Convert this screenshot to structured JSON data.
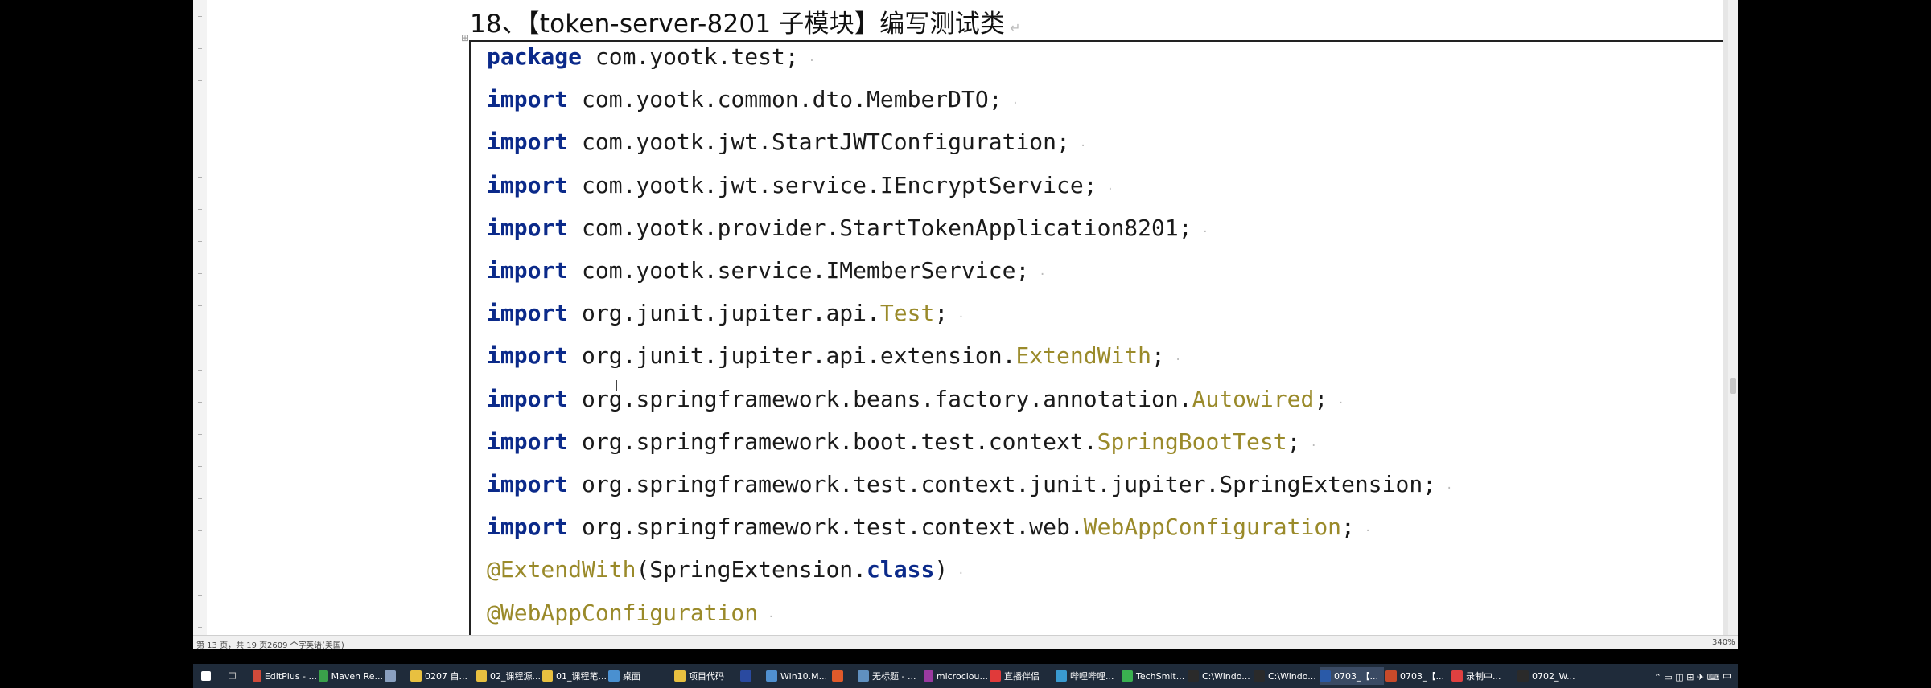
{
  "document": {
    "heading": "18、【token-server-8201 子模块】编写测试类",
    "code_lines": [
      [
        {
          "t": "package",
          "c": "kw"
        },
        {
          "t": " com.yootk.test;",
          "c": ""
        }
      ],
      [
        {
          "t": "import",
          "c": "kw"
        },
        {
          "t": " com.yootk.common.dto.MemberDTO;",
          "c": ""
        }
      ],
      [
        {
          "t": "import",
          "c": "kw"
        },
        {
          "t": " com.yootk.jwt.StartJWTConfiguration;",
          "c": ""
        }
      ],
      [
        {
          "t": "import",
          "c": "kw"
        },
        {
          "t": " com.yootk.jwt.service.IEncryptService;",
          "c": ""
        }
      ],
      [
        {
          "t": "import",
          "c": "kw"
        },
        {
          "t": " com.yootk.provider.StartTokenApplication8201;",
          "c": ""
        }
      ],
      [
        {
          "t": "import",
          "c": "kw"
        },
        {
          "t": " com.yootk.service.IMemberService;",
          "c": ""
        }
      ],
      [
        {
          "t": "import",
          "c": "kw"
        },
        {
          "t": " org.junit.jupiter.api.",
          "c": ""
        },
        {
          "t": "Test",
          "c": "cls"
        },
        {
          "t": ";",
          "c": ""
        }
      ],
      [
        {
          "t": "import",
          "c": "kw"
        },
        {
          "t": " org.junit.jupiter.api.extension.",
          "c": ""
        },
        {
          "t": "ExtendWith",
          "c": "cls"
        },
        {
          "t": ";",
          "c": ""
        }
      ],
      [
        {
          "t": "import",
          "c": "kw"
        },
        {
          "t": " org.springframework.beans.factory.annotation.",
          "c": ""
        },
        {
          "t": "Autowired",
          "c": "cls"
        },
        {
          "t": ";",
          "c": ""
        }
      ],
      [
        {
          "t": "import",
          "c": "kw"
        },
        {
          "t": " org.springframework.boot.test.context.",
          "c": ""
        },
        {
          "t": "SpringBootTest",
          "c": "cls"
        },
        {
          "t": ";",
          "c": ""
        }
      ],
      [
        {
          "t": "import",
          "c": "kw"
        },
        {
          "t": " org.springframework.test.context.junit.jupiter.SpringExtension;",
          "c": ""
        }
      ],
      [
        {
          "t": "import",
          "c": "kw"
        },
        {
          "t": " org.springframework.test.context.web.",
          "c": ""
        },
        {
          "t": "WebAppConfiguration",
          "c": "cls"
        },
        {
          "t": ";",
          "c": ""
        }
      ],
      [
        {
          "t": "@ExtendWith",
          "c": "ann"
        },
        {
          "t": "(SpringExtension.",
          "c": ""
        },
        {
          "t": "class",
          "c": "kw"
        },
        {
          "t": ")",
          "c": ""
        }
      ],
      [
        {
          "t": "@WebAppConfiguration",
          "c": "ann"
        }
      ]
    ]
  },
  "status_bar": {
    "page_info": "第 13 页，共 19 页",
    "word_count": "2609 个字",
    "language": "英语(美国)",
    "zoom": "340%"
  },
  "taskbar": {
    "start_icon": "windows-icon",
    "items": [
      {
        "label": "EditPlus - ...",
        "color": "#d04a3a",
        "active": false
      },
      {
        "label": "Maven Re...",
        "color": "#3aa04a",
        "active": false
      },
      {
        "label": "",
        "color": "#8aa0c0",
        "active": false
      },
      {
        "label": "0207 自...",
        "color": "#e8c040",
        "active": false
      },
      {
        "label": "02_课程源...",
        "color": "#e8c040",
        "active": false
      },
      {
        "label": "01_课程笔...",
        "color": "#e8c040",
        "active": false
      },
      {
        "label": "桌面",
        "color": "#4a90d0",
        "active": false
      },
      {
        "label": "项目代码",
        "color": "#e8c040",
        "active": false
      },
      {
        "label": "",
        "color": "#2a4aa0",
        "active": false
      },
      {
        "label": "Win10.M...",
        "color": "#5090d0",
        "active": false
      },
      {
        "label": "",
        "color": "#e05a2a",
        "active": false
      },
      {
        "label": "无标题 - ...",
        "color": "#6090c0",
        "active": false
      },
      {
        "label": "microclou...",
        "color": "#9a3aa0",
        "active": false
      },
      {
        "label": "直播伴侣",
        "color": "#e03a3a",
        "active": false
      },
      {
        "label": "哔哩哔哩...",
        "color": "#3a9ad0",
        "active": false
      },
      {
        "label": "TechSmit...",
        "color": "#3ab050",
        "active": false
      },
      {
        "label": "C:\\Windo...",
        "color": "#2a2a2a",
        "active": false
      },
      {
        "label": "C:\\Windo...",
        "color": "#2a2a2a",
        "active": false
      },
      {
        "label": "0703_【...",
        "color": "#2a5aa8",
        "active": true
      },
      {
        "label": "0703_【...",
        "color": "#c84a2a",
        "active": false
      },
      {
        "label": "录制中...",
        "color": "#e04040",
        "active": false
      },
      {
        "label": "0702_W...",
        "color": "#2a2a2a",
        "active": false
      }
    ]
  }
}
